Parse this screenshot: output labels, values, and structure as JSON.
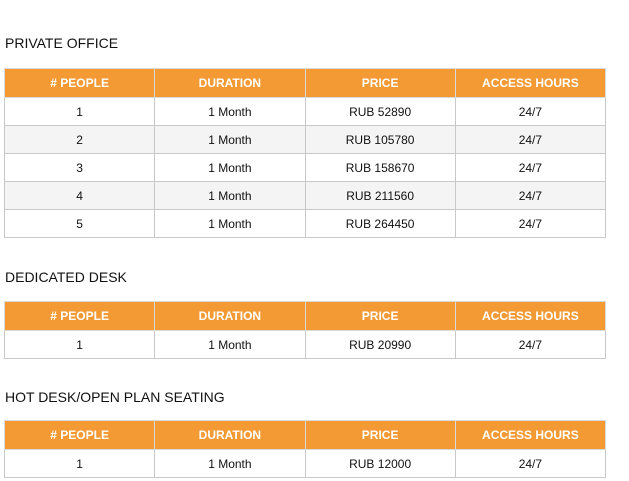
{
  "headers": [
    "# PEOPLE",
    "DURATION",
    "PRICE",
    "ACCESS HOURS"
  ],
  "sections": [
    {
      "title": "PRIVATE OFFICE",
      "rows": [
        [
          "1",
          "1 Month",
          "RUB 52890",
          "24/7"
        ],
        [
          "2",
          "1 Month",
          "RUB 105780",
          "24/7"
        ],
        [
          "3",
          "1 Month",
          "RUB 158670",
          "24/7"
        ],
        [
          "4",
          "1 Month",
          "RUB 211560",
          "24/7"
        ],
        [
          "5",
          "1 Month",
          "RUB 264450",
          "24/7"
        ]
      ]
    },
    {
      "title": "DEDICATED DESK",
      "rows": [
        [
          "1",
          "1 Month",
          "RUB 20990",
          "24/7"
        ]
      ]
    },
    {
      "title": "HOT DESK/OPEN PLAN SEATING",
      "rows": [
        [
          "1",
          "1 Month",
          "RUB 12000",
          "24/7"
        ]
      ]
    }
  ],
  "colors": {
    "header_bg": "#f39a34",
    "header_text": "#ffffff",
    "alt_row_bg": "#f4f4f4"
  }
}
